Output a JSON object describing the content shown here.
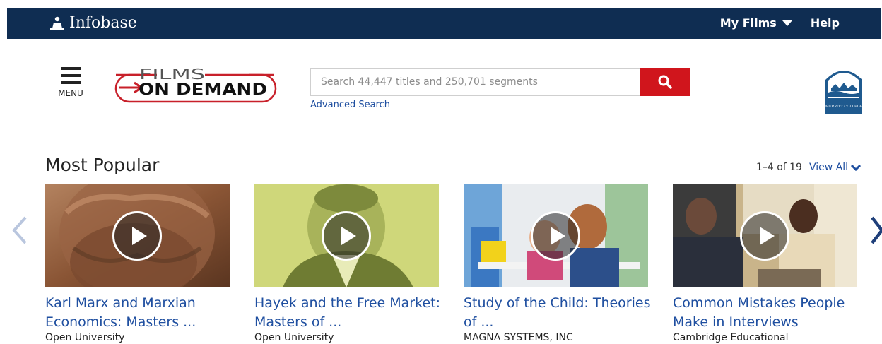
{
  "topbar": {
    "brand": "Infobase",
    "my_films": "My Films",
    "help": "Help"
  },
  "header": {
    "menu_label": "MENU",
    "logo_line1": "FILMS",
    "logo_line2": "ON DEMAND",
    "search_placeholder": "Search 44,447 titles and 250,701 segments",
    "advanced_search": "Advanced Search",
    "college_logo_text": "MERRITT COLLEGE"
  },
  "section": {
    "title": "Most Popular",
    "count": "1–4 of 19",
    "view_all": "View All"
  },
  "cards": [
    {
      "title": "Karl Marx and Marxian Economics: Masters ...",
      "publisher": "Open University"
    },
    {
      "title": "Hayek and the Free Market: Masters of ...",
      "publisher": "Open University"
    },
    {
      "title": "Study of the Child: Theories of ...",
      "publisher": "MAGNA SYSTEMS, INC"
    },
    {
      "title": "Common Mistakes People Make in Interviews",
      "publisher": "Cambridge Educational"
    }
  ],
  "colors": {
    "topbar": "#0f2d52",
    "search_button": "#d0151c",
    "link": "#1f4fa0",
    "logo_red": "#c8202a"
  },
  "icons": {
    "brand": "infobase-logo-icon",
    "menu": "hamburger-icon",
    "search": "search-icon",
    "prev": "chevron-left-icon",
    "next": "chevron-right-icon",
    "play": "play-icon"
  }
}
